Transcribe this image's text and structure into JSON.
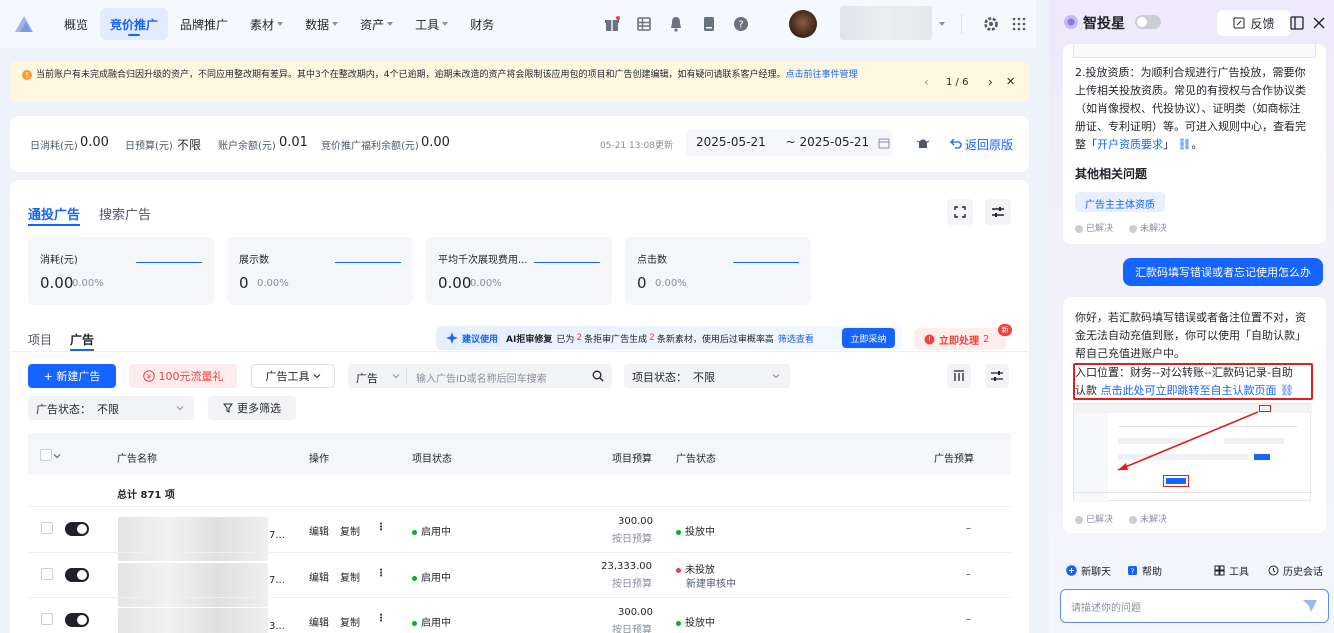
{
  "nav": {
    "items": [
      "概览",
      "竞价推广",
      "品牌推广",
      "素材",
      "数据",
      "资产",
      "工具",
      "财务"
    ],
    "active": 1,
    "with_caret": [
      3,
      4,
      5,
      6
    ]
  },
  "notice": {
    "text": "当前账户有未完成融合归因升级的资产，不同应用整改期有差异。其中3个在整改期内，4个已逾期，逾期未改造的资产将会限制该应用包的项目和广告创建编辑，如有疑问请联系客户经理。",
    "link": "点击前往事件管理",
    "pager": "1 / 6"
  },
  "stats": {
    "daily_spend_label": "日消耗(元)",
    "daily_spend": "0.00",
    "daily_budget_label": "日预算(元)",
    "daily_budget": "不限",
    "balance_label": "账户余额(元)",
    "balance": "0.01",
    "welfare_label": "竞价推广福利余额(元)",
    "welfare": "0.00",
    "updated": "05-21 13:08更新",
    "date_start": "2025-05-21",
    "date_end": "~ 2025-05-21",
    "back": "返回原版"
  },
  "tabs": {
    "main": "通投广告",
    "search": "搜索广告"
  },
  "metrics": [
    {
      "label": "消耗(元)",
      "value": "0.00",
      "pct": "0.00%"
    },
    {
      "label": "展示数",
      "value": "0",
      "pct": "0.00%"
    },
    {
      "label": "平均千次展现费用...",
      "value": "0.00",
      "pct": "0.00%"
    },
    {
      "label": "点击数",
      "value": "0",
      "pct": "0.00%"
    }
  ],
  "subtabs": {
    "project": "项目",
    "ad": "广告"
  },
  "promo": {
    "tag": "建议使用",
    "title": "AI拒审修复",
    "pre": "已为",
    "n1": "2",
    "mid": "条拒审广告生成",
    "n2": "2",
    "post": "条新素材，使用后过审概率高",
    "filter": "筛选查看",
    "adopt": "立即采纳",
    "handle": "立即处理",
    "handle_n": "2",
    "new": "新"
  },
  "toolbar": {
    "new_ad": "+ 新建广告",
    "traffic": "100元流量礼",
    "tools": "广告工具",
    "select_type": "广告",
    "search_ph": "输入广告ID或名称后回车搜索",
    "project_status_label": "项目状态：",
    "project_status": "不限",
    "ad_status_label": "广告状态：",
    "ad_status": "不限",
    "more_filter": "更多筛选"
  },
  "table": {
    "headers": [
      "广告名称",
      "操作",
      "项目状态",
      "项目预算",
      "广告状态",
      "广告预算"
    ],
    "total": "总计 871 项",
    "rows": [
      {
        "op1": "编辑",
        "op2": "复制",
        "suffix": "7...",
        "proj_status": "启用中",
        "budget": "300.00",
        "budget_type": "按日预算",
        "ad_status": "投放中",
        "ad_status_color": "#00b42a",
        "ad_sub": "",
        "ad_budget": "–"
      },
      {
        "op1": "编辑",
        "op2": "复制",
        "suffix": "7...",
        "proj_status": "启用中",
        "budget": "23,333.00",
        "budget_type": "按日预算",
        "ad_status": "未投放",
        "ad_status_color": "#f53f3f",
        "ad_sub": "新建审核中",
        "ad_budget": "–"
      },
      {
        "op1": "编辑",
        "op2": "复制",
        "suffix": "3...",
        "proj_status": "启用中",
        "budget": "300.00",
        "budget_type": "按日预算",
        "ad_status": "投放中",
        "ad_status_color": "#00b42a",
        "ad_sub": "",
        "ad_budget": "–"
      }
    ]
  },
  "panel": {
    "title": "智投星",
    "feedback": "反馈",
    "ans1": [
      "2.投放资质：为顺利合规进行广告投放，需要你",
      "上传相关投放资质。常见的有授权与合作协议类",
      "（如肖像授权、代投协议）、证明类（如商标注",
      "册证、专利证明）等。可进入规则中心，查看完"
    ],
    "ans1_last_pre": "整「",
    "ans1_link": "开户资质要求",
    "ans1_last_post": "」",
    "related_title": "其他相关问题",
    "related_tag": "广告主主体资质",
    "solved": "已解决",
    "unsolved": "未解决",
    "question": "汇款码填写错误或者忘记使用怎么办",
    "ans2": [
      "你好，若汇款码填写错误或者备注位置不对，资",
      "金无法自动充值到账，你可以使用「自助认款」",
      "帮自己充值进账户中。"
    ],
    "entry_line1": "入口位置：财务--对公转账--汇款码记录-自助",
    "entry_line2": "认款",
    "entry_link": "点击此处可立即跳转至自主认款页面",
    "new_chat": "新聊天",
    "help": "帮助",
    "tools": "工具",
    "history": "历史会话",
    "input_ph": "请描述你的问题"
  },
  "colors": {
    "accent": "#1664ff",
    "success": "#00b42a",
    "danger": "#f53f3f"
  }
}
